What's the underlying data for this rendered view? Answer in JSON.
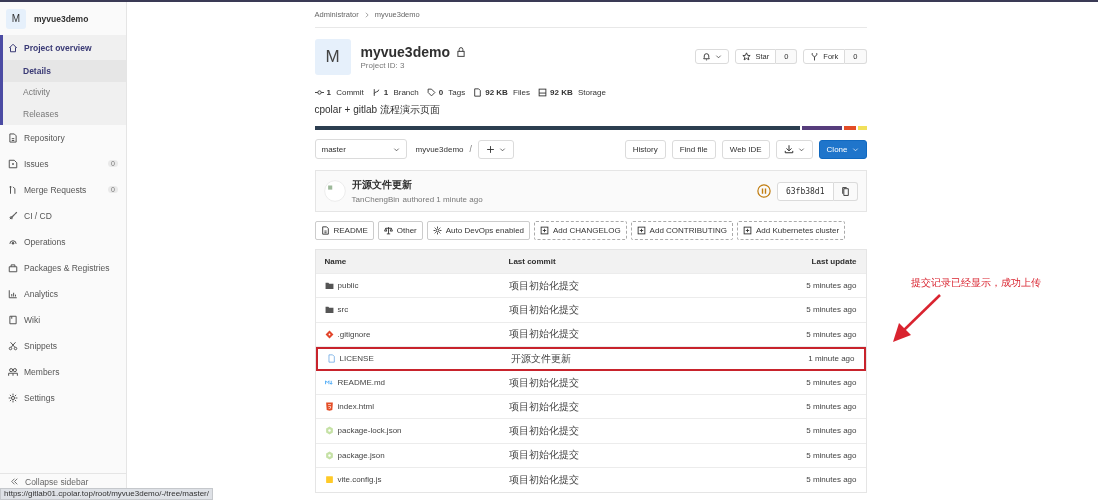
{
  "sidebar": {
    "project": {
      "avatar": "M",
      "name": "myvue3demo"
    },
    "items": [
      {
        "label": "Project overview",
        "selected": true,
        "expanded": true,
        "children": [
          {
            "label": "Details",
            "selected": true
          },
          {
            "label": "Activity",
            "selected": false
          },
          {
            "label": "Releases",
            "selected": false
          }
        ]
      },
      {
        "label": "Repository",
        "selected": false
      },
      {
        "label": "Issues",
        "selected": false,
        "badge": "0"
      },
      {
        "label": "Merge Requests",
        "selected": false,
        "badge": "0"
      },
      {
        "label": "CI / CD",
        "selected": false
      },
      {
        "label": "Operations",
        "selected": false
      },
      {
        "label": "Packages & Registries",
        "selected": false
      },
      {
        "label": "Analytics",
        "selected": false
      },
      {
        "label": "Wiki",
        "selected": false
      },
      {
        "label": "Snippets",
        "selected": false
      },
      {
        "label": "Members",
        "selected": false
      },
      {
        "label": "Settings",
        "selected": false
      }
    ],
    "collapse_label": "Collapse sidebar"
  },
  "breadcrumb": [
    "Administrator",
    "myvue3demo"
  ],
  "project": {
    "avatar": "M",
    "name": "myvue3demo",
    "private": true,
    "id_text": "Project ID: 3",
    "star": {
      "label": "Star",
      "count": "0"
    },
    "fork": {
      "label": "Fork",
      "count": "0"
    },
    "stats": [
      {
        "value": "1",
        "label": "Commit"
      },
      {
        "value": "1",
        "label": "Branch"
      },
      {
        "value": "0",
        "label": "Tags"
      },
      {
        "value": "92 KB",
        "label": "Files"
      },
      {
        "value": "92 KB",
        "label": "Storage"
      }
    ],
    "description": "cpolar + gitlab 流程演示页面"
  },
  "toolbar": {
    "branch": "master",
    "path": "myvue3demo",
    "separator": "/",
    "buttons": [
      {
        "label": "History",
        "kind": "plain"
      },
      {
        "label": "Find file",
        "kind": "plain"
      },
      {
        "label": "Web IDE",
        "kind": "plain"
      },
      {
        "kind": "download"
      },
      {
        "label": "Clone",
        "kind": "primary"
      }
    ]
  },
  "commit": {
    "title": "开源文件更新",
    "author": "TanChengBin",
    "meta": "authored 1 minute ago",
    "sha": "63fb38d1"
  },
  "quick_links": [
    {
      "label": "README",
      "kind": "file"
    },
    {
      "label": "Other",
      "kind": "license"
    },
    {
      "label": "Auto DevOps enabled",
      "kind": "devops"
    },
    {
      "label": "Add CHANGELOG",
      "kind": "add"
    },
    {
      "label": "Add CONTRIBUTING",
      "kind": "add"
    },
    {
      "label": "Add Kubernetes cluster",
      "kind": "add"
    }
  ],
  "table": {
    "columns": [
      "Name",
      "Last commit",
      "Last update"
    ],
    "rows": [
      {
        "name": "public",
        "kind": "folder",
        "commit": "项目初始化提交",
        "update": "5 minutes ago",
        "highlighted": false
      },
      {
        "name": "src",
        "kind": "folder",
        "commit": "项目初始化提交",
        "update": "5 minutes ago",
        "highlighted": false
      },
      {
        "name": ".gitignore",
        "kind": "git",
        "commit": "项目初始化提交",
        "update": "5 minutes ago",
        "highlighted": false
      },
      {
        "name": "LICENSE",
        "kind": "file",
        "commit": "开源文件更新",
        "update": "1 minute ago",
        "highlighted": true
      },
      {
        "name": "README.md",
        "kind": "markdown",
        "commit": "项目初始化提交",
        "update": "5 minutes ago",
        "highlighted": false
      },
      {
        "name": "index.html",
        "kind": "html",
        "commit": "项目初始化提交",
        "update": "5 minutes ago",
        "highlighted": false
      },
      {
        "name": "package-lock.json",
        "kind": "json",
        "commit": "项目初始化提交",
        "update": "5 minutes ago",
        "highlighted": false
      },
      {
        "name": "package.json",
        "kind": "json",
        "commit": "项目初始化提交",
        "update": "5 minutes ago",
        "highlighted": false
      },
      {
        "name": "vite.config.js",
        "kind": "js",
        "commit": "项目初始化提交",
        "update": "5 minutes ago",
        "highlighted": false
      }
    ]
  },
  "annotation": {
    "text": "提交记录已经显示，成功上传"
  },
  "status_bar": {
    "url": "https://gitlab01.cpolar.top/root/myvue3demo/-/tree/master/"
  }
}
